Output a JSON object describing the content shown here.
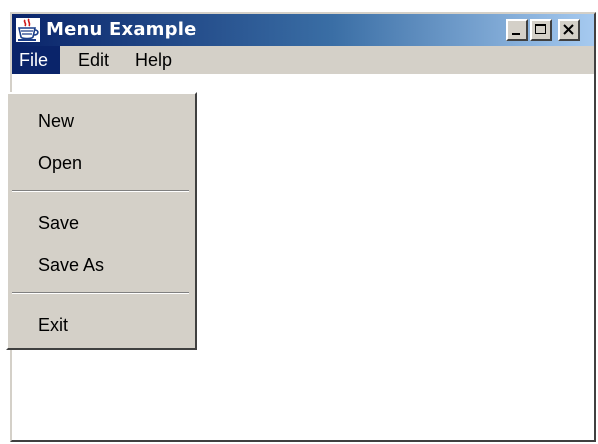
{
  "window": {
    "title": "Menu Example",
    "controls": [
      "minimize",
      "maximize",
      "close"
    ]
  },
  "menubar": {
    "items": [
      {
        "label": "File",
        "active": true
      },
      {
        "label": "Edit",
        "active": false
      },
      {
        "label": "Help",
        "active": false
      }
    ]
  },
  "file_menu": {
    "items": [
      "New",
      "Open",
      "Save",
      "Save As",
      "Exit"
    ],
    "separators_after": [
      "Open",
      "Save As"
    ]
  },
  "colors": {
    "title_gradient_start": "#0a246a",
    "title_gradient_end": "#a6caf0",
    "menu_active_bg": "#0a246a",
    "face": "#d4d0c8",
    "client_bg": "#ffffff"
  }
}
